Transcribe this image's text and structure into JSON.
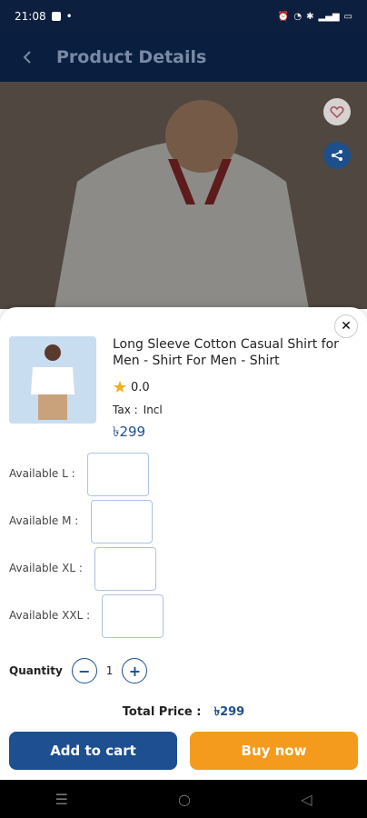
{
  "status_bar": {
    "time": "21:08"
  },
  "header": {
    "title": "Product Details"
  },
  "product": {
    "name": "Long Sleeve Cotton Casual Shirt for Men - Shirt For Men - Shirt",
    "rating": "0.0",
    "tax_label": "Tax :",
    "tax_value": "Incl",
    "price": "৳299"
  },
  "sizes": [
    {
      "label": "Available  L :"
    },
    {
      "label": "Available  M :"
    },
    {
      "label": "Available  XL :"
    },
    {
      "label": "Available  XXL :"
    }
  ],
  "quantity": {
    "label": "Quantity",
    "value": "1"
  },
  "total": {
    "label": "Total Price :",
    "value": "৳299"
  },
  "buttons": {
    "add_to_cart": "Add to cart",
    "buy_now": "Buy now"
  },
  "colors": {
    "primary": "#1d4f91",
    "accent": "#f49b1d",
    "header_bg": "#0a1f40"
  }
}
